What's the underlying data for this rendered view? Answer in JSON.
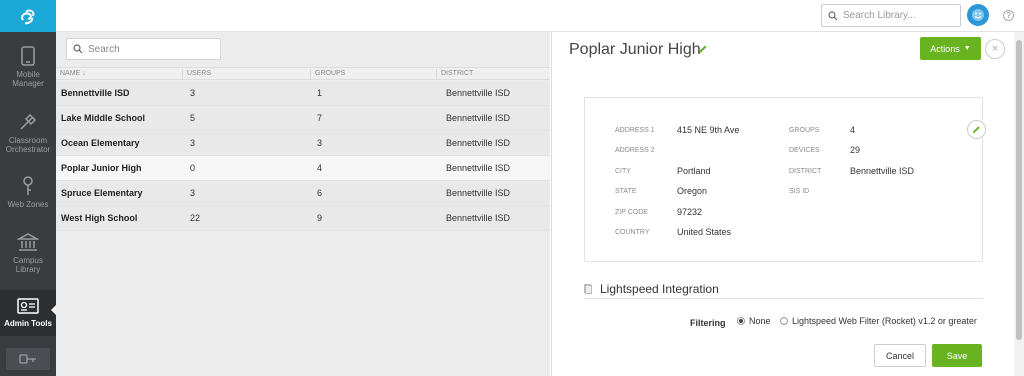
{
  "sidebar": {
    "items": [
      {
        "label": "Mobile Manager",
        "icon": "tablet-icon"
      },
      {
        "label": "Classroom Orchestrator",
        "icon": "baton-icon"
      },
      {
        "label": "Web Zones",
        "icon": "key-icon"
      },
      {
        "label": "Campus Library",
        "icon": "library-icon"
      },
      {
        "label": "Admin Tools",
        "icon": "id-card-icon",
        "active": true
      }
    ]
  },
  "topbar": {
    "search_placeholder": "Search Library...",
    "help": "?"
  },
  "list": {
    "search_placeholder": "Search",
    "columns": [
      "NAME",
      "USERS",
      "GROUPS",
      "DISTRICT"
    ],
    "sort_indicator": "↓",
    "rows": [
      {
        "name": "Bennettville ISD",
        "users": "3",
        "groups": "1",
        "district": "Bennettville ISD"
      },
      {
        "name": "Lake Middle School",
        "users": "5",
        "groups": "7",
        "district": "Bennettville ISD"
      },
      {
        "name": "Ocean Elementary",
        "users": "3",
        "groups": "3",
        "district": "Bennettville ISD"
      },
      {
        "name": "Poplar Junior High",
        "users": "0",
        "groups": "4",
        "district": "Bennettville ISD"
      },
      {
        "name": "Spruce Elementary",
        "users": "3",
        "groups": "6",
        "district": "Bennettville ISD"
      },
      {
        "name": "West High School",
        "users": "22",
        "groups": "9",
        "district": "Bennettville ISD"
      }
    ],
    "selected_index": 3
  },
  "detail": {
    "title": "Poplar Junior High",
    "actions_label": "Actions",
    "close": "×",
    "fields": {
      "address1_label": "ADDRESS 1",
      "address1": "415 NE 9th Ave",
      "address2_label": "ADDRESS 2",
      "address2": "",
      "city_label": "CITY",
      "city": "Portland",
      "state_label": "STATE",
      "state": "Oregon",
      "zip_label": "ZIP CODE",
      "zip": "97232",
      "country_label": "COUNTRY",
      "country": "United States",
      "groups_label": "GROUPS",
      "groups": "4",
      "devices_label": "DEVICES",
      "devices": "29",
      "district_label": "DISTRICT",
      "district": "Bennettville ISD",
      "sis_label": "SIS ID",
      "sis": ""
    },
    "integration": {
      "title": "Lightspeed Integration",
      "filtering_label": "Filtering",
      "options": [
        "None",
        "Lightspeed Web Filter (Rocket) v1.2 or greater"
      ],
      "selected": "None"
    },
    "cancel_label": "Cancel",
    "save_label": "Save"
  },
  "colors": {
    "accent_green": "#6ab320",
    "logo_blue": "#1aa9d6",
    "sidebar_bg": "#3a3d40"
  }
}
